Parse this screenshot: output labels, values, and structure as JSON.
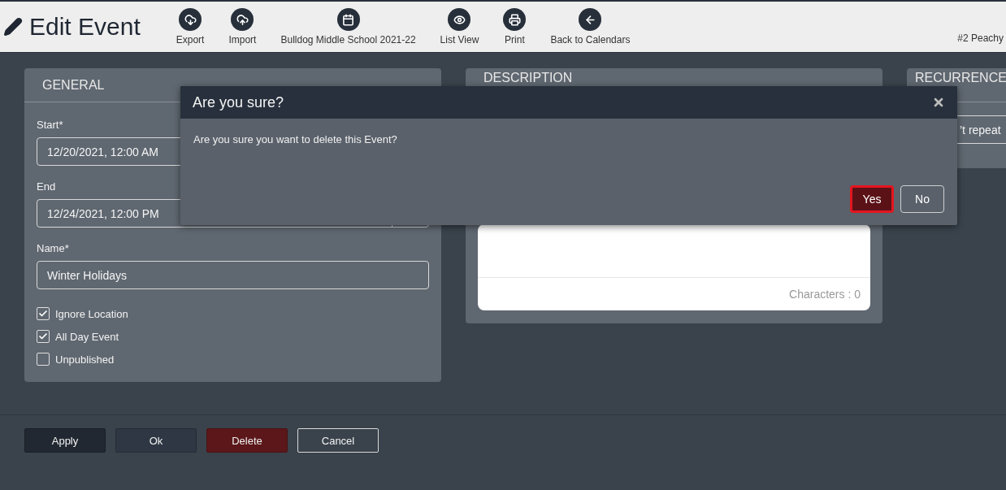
{
  "header": {
    "title": "Edit Event",
    "toolbar": [
      {
        "kind": "export",
        "label": "Export"
      },
      {
        "kind": "import",
        "label": "Import"
      },
      {
        "kind": "calendar",
        "label": "Bulldog Middle School 2021-22"
      },
      {
        "kind": "list",
        "label": "List View"
      },
      {
        "kind": "print",
        "label": "Print"
      },
      {
        "kind": "back",
        "label": "Back to Calendars"
      }
    ],
    "account": "#2 Peachy"
  },
  "general": {
    "title": "GENERAL",
    "start": {
      "label": "Start*",
      "value": "12/20/2021, 12:00 AM"
    },
    "end": {
      "label": "End",
      "value": "12/24/2021, 12:00 PM"
    },
    "name": {
      "label": "Name*",
      "value": "Winter Holidays"
    },
    "options": [
      {
        "label": "Ignore Location",
        "checked": true
      },
      {
        "label": "All Day Event",
        "checked": true
      },
      {
        "label": "Unpublished",
        "checked": false
      }
    ]
  },
  "description": {
    "title": "DESCRIPTION",
    "counter": "Characters : 0"
  },
  "recurrence": {
    "title": "RECURRENCE",
    "repeat": "’t repeat"
  },
  "actions": [
    {
      "kind": "apply",
      "label": "Apply"
    },
    {
      "kind": "ok",
      "label": "Ok"
    },
    {
      "kind": "delete",
      "label": "Delete"
    },
    {
      "kind": "cancel",
      "label": "Cancel"
    }
  ],
  "dialog": {
    "title": "Are you sure?",
    "message": "Are you sure you want to delete this Event?",
    "buttons": [
      {
        "kind": "confirm",
        "label": "Yes",
        "focused": true
      },
      {
        "kind": "dismiss",
        "label": "No",
        "focused": false
      }
    ]
  }
}
